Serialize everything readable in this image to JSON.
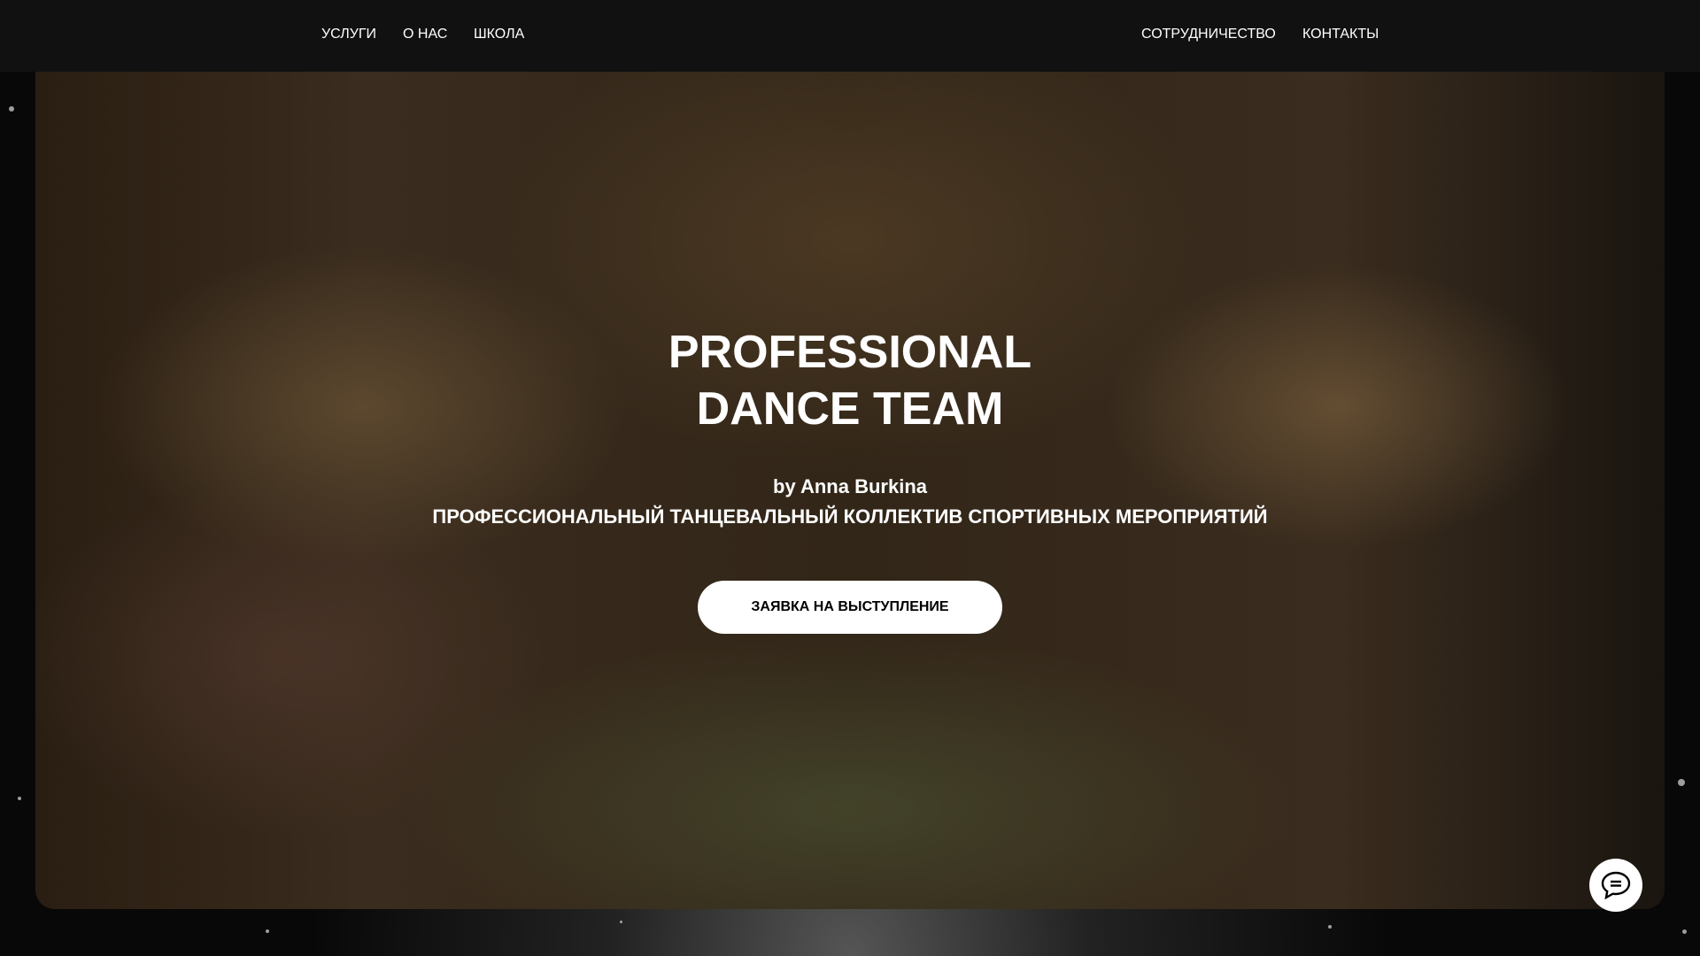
{
  "nav": {
    "left": [
      "УСЛУГИ",
      "О НАС",
      "ШКОЛА"
    ],
    "right": [
      "СОТРУДНИЧЕСТВО",
      "КОНТАКТЫ"
    ]
  },
  "hero": {
    "title_line1": "PROFESSIONAL",
    "title_line2": "DANCE TEAM",
    "byline": "by Anna Burkina",
    "subtitle": "ПРОФЕССИОНАЛЬНЫЙ ТАНЦЕВАЛЬНЫЙ КОЛЛЕКТИВ СПОРТИВНЫХ МЕРОПРИЯТИЙ",
    "cta_label": "ЗАЯВКА НА ВЫСТУПЛЕНИЕ"
  },
  "chat_widget": {
    "icon": "chat-bubble-icon"
  }
}
